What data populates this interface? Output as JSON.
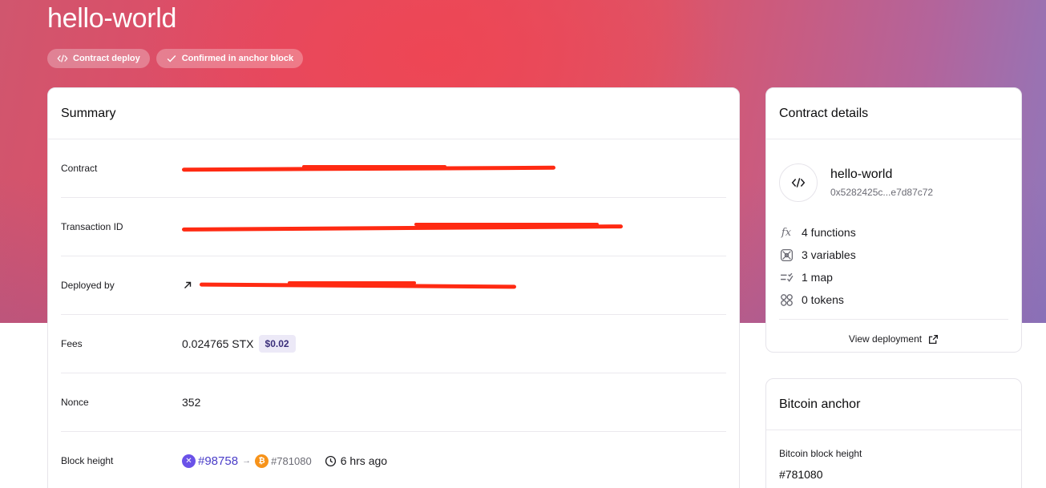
{
  "page": {
    "title": "hello-world"
  },
  "badges": [
    {
      "label": "Contract deploy",
      "icon": "code-icon"
    },
    {
      "label": "Confirmed in anchor block",
      "icon": "check-icon"
    }
  ],
  "summary": {
    "title": "Summary",
    "contract_label": "Contract",
    "txid_label": "Transaction ID",
    "deployed_by_label": "Deployed by",
    "fees_label": "Fees",
    "fees_value": "0.024765 STX",
    "fees_usd": "$0.02",
    "nonce_label": "Nonce",
    "nonce_value": "352",
    "block_height_label": "Block height",
    "stacks_block": "#98758",
    "bitcoin_block": "#781080",
    "time_ago": "6 hrs ago"
  },
  "contract_details": {
    "title": "Contract details",
    "name": "hello-world",
    "hash": "0x5282425c...e7d87c72",
    "stats": [
      {
        "icon": "function-icon",
        "label": "4 functions"
      },
      {
        "icon": "variables-icon",
        "label": "3 variables"
      },
      {
        "icon": "map-icon",
        "label": "1 map"
      },
      {
        "icon": "tokens-icon",
        "label": "0 tokens"
      }
    ],
    "view_deployment": "View deployment"
  },
  "bitcoin_anchor": {
    "title": "Bitcoin anchor",
    "block_height_label": "Bitcoin block height",
    "block_height_value": "#781080"
  },
  "colors": {
    "accent_red": "#e84a5c",
    "accent_purple": "#8f78bc",
    "redaction": "#ff2a12",
    "stacks": "#6a52e8",
    "bitcoin": "#f7931a"
  }
}
